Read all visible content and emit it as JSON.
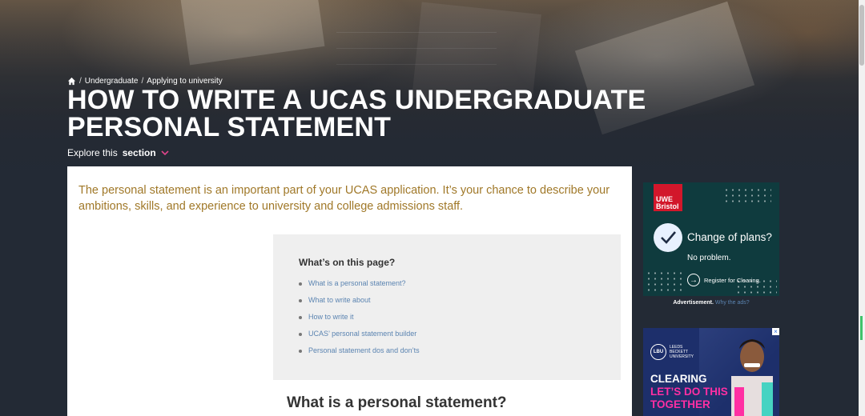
{
  "breadcrumb": {
    "items": [
      "Undergraduate",
      "Applying to university"
    ],
    "separator": "/"
  },
  "page_title": "HOW TO WRITE A UCAS UNDERGRADUATE PERSONAL STATEMENT",
  "explore": {
    "prefix": "Explore this",
    "bold": "section"
  },
  "intro_text": "The personal statement is an important part of your UCAS application. It’s your chance to describe your ambitions, skills, and experience to university and college admissions staff.",
  "toc": {
    "heading": "What’s on this page?",
    "items": [
      "What is a personal statement?",
      "What to write about",
      "How to write it",
      "UCAS’ personal statement builder",
      "Personal statement dos and don’ts"
    ]
  },
  "section_heading": "What is a personal statement?",
  "ad1": {
    "logo_line1": "UWE",
    "logo_line2": "Bristol",
    "headline": "Change of plans?",
    "sub": "No problem.",
    "cta": "Register for Clearing."
  },
  "ad_label": {
    "label": "Advertisement.",
    "link": "Why the ads?"
  },
  "ad2": {
    "close": "×",
    "uni_mark": "LBU",
    "uni_line1": "LEEDS",
    "uni_line2": "BECKETT",
    "uni_line3": "UNIVERSITY",
    "line1": "CLEARING",
    "line2": "LET’S DO THIS",
    "line3": "TOGETHER"
  },
  "colors": {
    "intro": "#a07828",
    "link": "#5b84b1",
    "accent_pink": "#e0458a",
    "ad1_bg": "#0f3b3e",
    "ad2_bg": "#1d2f6b"
  }
}
